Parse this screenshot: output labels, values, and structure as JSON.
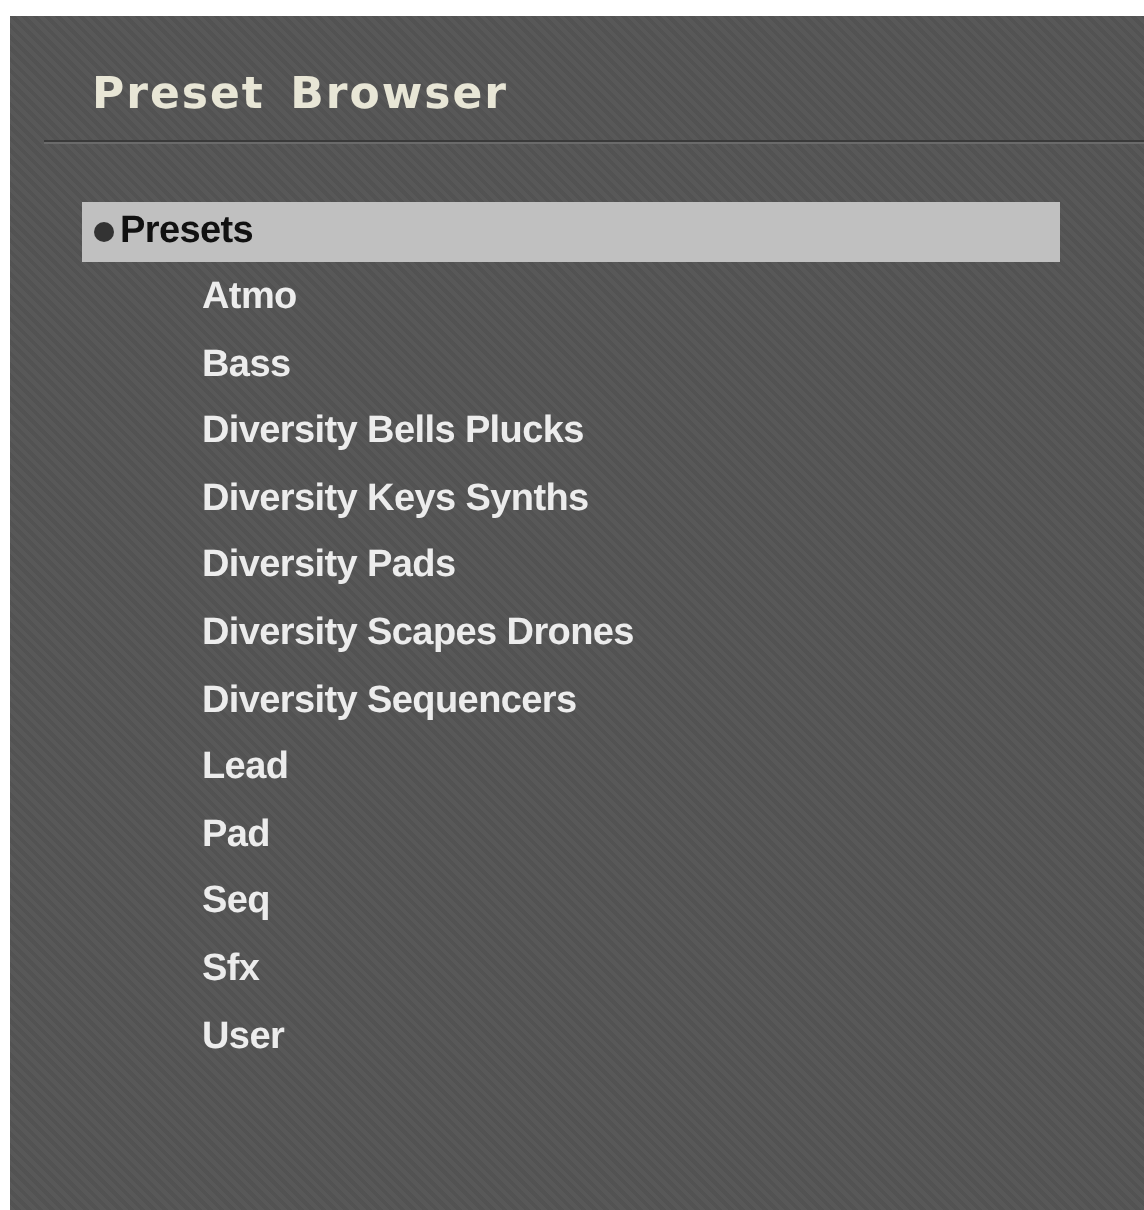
{
  "window": {
    "title": "Preset Browser"
  },
  "tree": [
    {
      "label": "Presets",
      "selected": true,
      "children": [
        {
          "label": "Atmo",
          "selected": false
        },
        {
          "label": "Bass",
          "selected": false
        },
        {
          "label": "Diversity Bells Plucks",
          "selected": false
        },
        {
          "label": "Diversity Keys Synths",
          "selected": false
        },
        {
          "label": "Diversity Pads",
          "selected": false
        },
        {
          "label": "Diversity Scapes Drones",
          "selected": false
        },
        {
          "label": "Diversity Sequencers",
          "selected": false
        },
        {
          "label": "Lead",
          "selected": false
        },
        {
          "label": "Pad",
          "selected": false
        },
        {
          "label": "Seq",
          "selected": false
        },
        {
          "label": "Sfx",
          "selected": false
        },
        {
          "label": "User",
          "selected": false
        }
      ]
    }
  ]
}
